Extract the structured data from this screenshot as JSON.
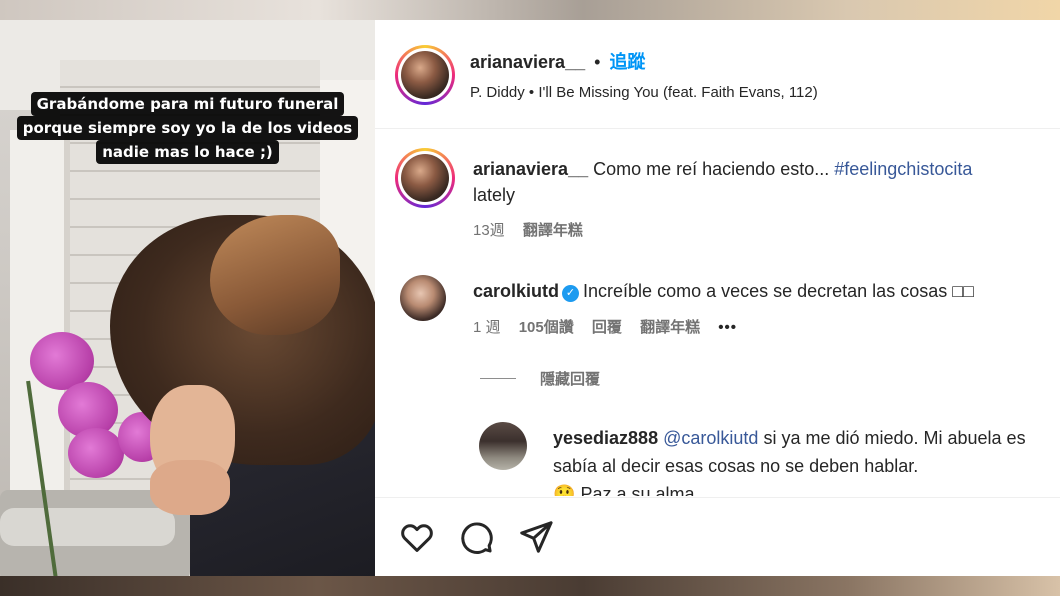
{
  "video": {
    "caption_lines": [
      "Grabándome para mi futuro funeral",
      "porque siempre soy yo la de los videos",
      "nadie mas lo hace ;)"
    ]
  },
  "header": {
    "username": "arianaviera__",
    "separator": "•",
    "follow_label": "追蹤",
    "music": "P. Diddy • I'll Be Missing You (feat. Faith Evans, 112)"
  },
  "comments": [
    {
      "username": "arianaviera__",
      "text": "Como me reí haciendo esto...",
      "hashtag": "#feelingchistocita",
      "text_cont": "lately",
      "time": "13週",
      "translate": "翻譯年糕"
    },
    {
      "username": "carolkiutd",
      "verified_mark": "✓",
      "text": "Increíble como a veces se decretan las cosas",
      "emoji_boxes": "□□",
      "time": "1 週",
      "likes": "105個讚",
      "reply_label": "回覆",
      "translate": "翻譯年糕",
      "more": "•••"
    }
  ],
  "hidden_replies_label": "隱藏回覆",
  "reply": {
    "username": "yesediaz888",
    "mention": "@carolkiutd",
    "text": "si ya me dió miedo. Mi abuela es sabía al decir esas cosas no se deben hablar.",
    "emoji": "😲",
    "text_cont": "Paz a su alma"
  },
  "actions": {
    "icons": [
      "heart-icon",
      "comment-icon",
      "share-icon"
    ]
  }
}
